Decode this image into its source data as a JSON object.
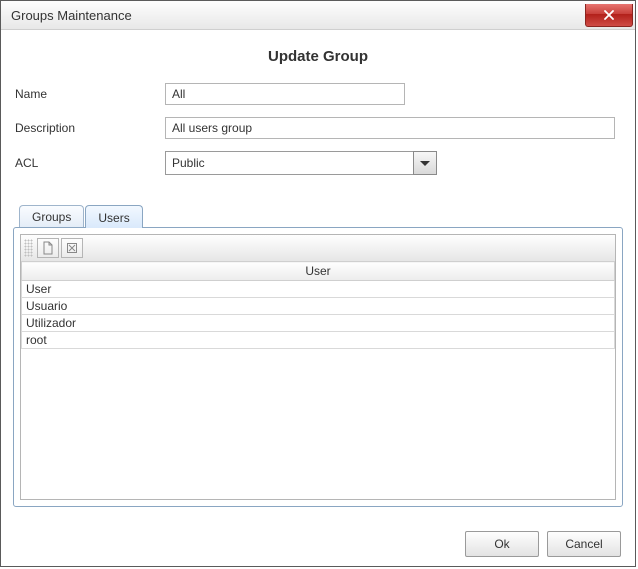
{
  "window": {
    "title": "Groups Maintenance",
    "close_icon": "close"
  },
  "page": {
    "title": "Update Group"
  },
  "form": {
    "name_label": "Name",
    "name_value": "All",
    "description_label": "Description",
    "description_value": "All users group",
    "acl_label": "ACL",
    "acl_value": "Public"
  },
  "tabs": {
    "groups": "Groups",
    "users": "Users",
    "active": "Users"
  },
  "user_table": {
    "header": "User",
    "rows": [
      "User",
      "Usuario",
      "Utilizador",
      "root"
    ]
  },
  "buttons": {
    "ok": "Ok",
    "cancel": "Cancel"
  }
}
